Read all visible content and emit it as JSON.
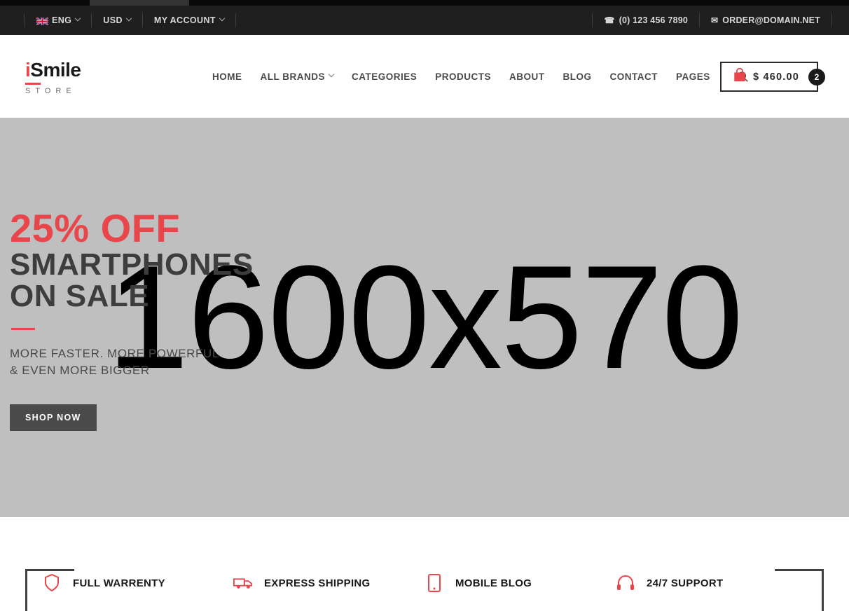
{
  "topbar": {
    "language": {
      "label": "ENG",
      "flag_icon": "uk-flag-icon",
      "chevron": "chevron-down-icon"
    },
    "currency": {
      "label": "USD",
      "chevron": "chevron-down-icon"
    },
    "account": {
      "label": "MY ACCOUNT",
      "chevron": "chevron-down-icon"
    },
    "phone": {
      "icon": "phone-icon",
      "value": "(0) 123 456 7890"
    },
    "email": {
      "icon": "envelope-icon",
      "value": "ORDER@DOMAIN.NET"
    }
  },
  "header": {
    "logo": {
      "accent_letter": "i",
      "name": "Smile",
      "subtitle": "STORE"
    },
    "nav": [
      {
        "label": "HOME",
        "has_dropdown": false
      },
      {
        "label": "ALL BRANDS",
        "has_dropdown": true
      },
      {
        "label": "CATEGORIES",
        "has_dropdown": false
      },
      {
        "label": "PRODUCTS",
        "has_dropdown": false
      },
      {
        "label": "ABOUT",
        "has_dropdown": false
      },
      {
        "label": "BLOG",
        "has_dropdown": false
      },
      {
        "label": "CONTACT",
        "has_dropdown": false
      },
      {
        "label": "PAGES",
        "has_dropdown": false
      }
    ],
    "search_icon": "search-icon",
    "cart": {
      "icon": "shopping-bag-icon",
      "total": "$ 460.00",
      "count": "2"
    }
  },
  "hero": {
    "placeholder_text": "1600x570",
    "discount": "25% OFF",
    "title_line1": "SMARTPHONES",
    "title_line2": "ON SALE",
    "subtitle_line1": "MORE FASTER. MORE POWERFUL",
    "subtitle_line2": "& EVEN MORE BIGGER",
    "cta_label": "SHOP NOW"
  },
  "features": [
    {
      "label": "FULL WARRENTY",
      "icon": "shield-icon"
    },
    {
      "label": "EXPRESS SHIPPING",
      "icon": "truck-icon"
    },
    {
      "label": "MOBILE BLOG",
      "icon": "phone-device-icon"
    },
    {
      "label": "24/7 SUPPORT",
      "icon": "headset-icon"
    }
  ],
  "colors": {
    "accent_red": "#e8464a",
    "topbar_bg": "#1f1f1f",
    "hero_bg": "#bfbfbf",
    "text_dark": "#3d3d3d"
  }
}
